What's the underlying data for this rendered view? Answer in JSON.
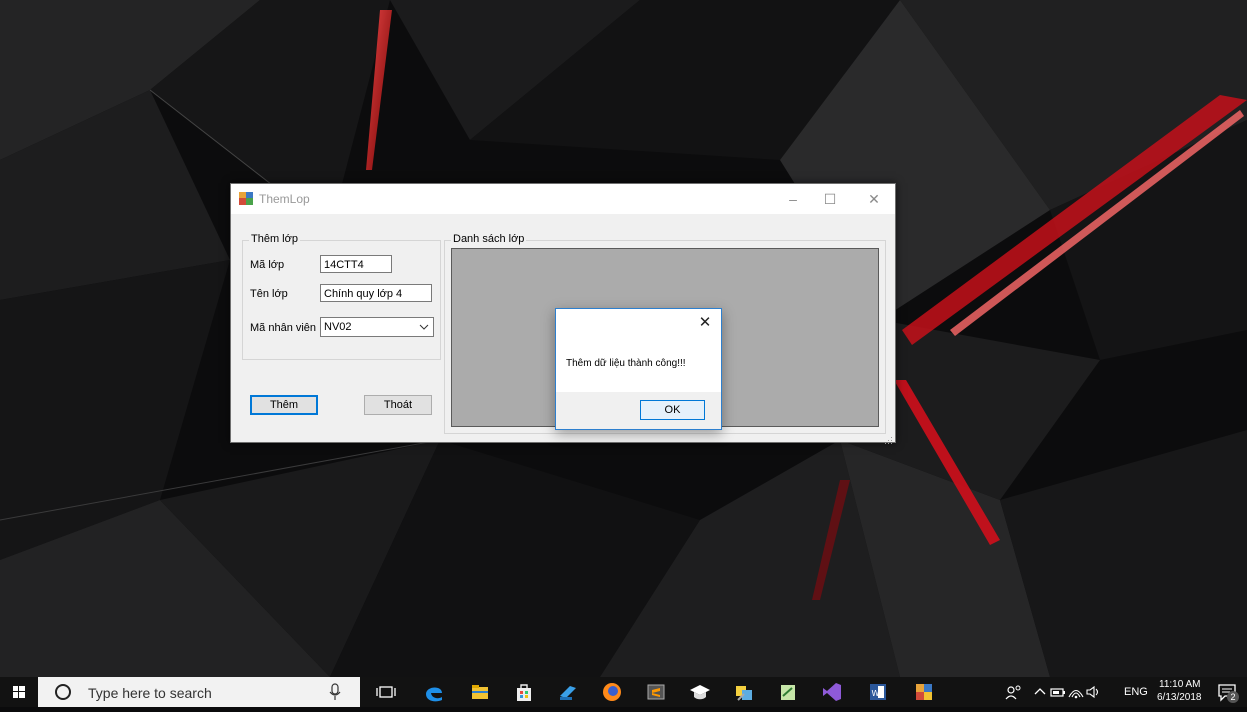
{
  "window": {
    "title": "ThemLop",
    "group_them_lop": {
      "legend": "Thêm lớp",
      "ma_lop_label": "Mã lớp",
      "ma_lop_value": "14CTT4",
      "ten_lop_label": "Tên lớp",
      "ten_lop_value": "Chính quy lớp 4",
      "ma_nv_label": "Mã nhân viên",
      "ma_nv_value": "NV02"
    },
    "buttons": {
      "them": "Thêm",
      "thoat": "Thoát"
    },
    "group_danh_sach": {
      "legend": "Danh sách lớp"
    }
  },
  "messagebox": {
    "text": "Thêm dữ liệu thành công!!!",
    "ok": "OK"
  },
  "taskbar": {
    "search_placeholder": "Type here to search",
    "language": "ENG",
    "time": "11:10 AM",
    "date": "6/13/2018",
    "notification_count": "2",
    "pinned_icons": [
      "microphone-icon",
      "task-view-icon",
      "edge-icon",
      "file-explorer-icon",
      "store-icon",
      "deploy-icon",
      "firefox-icon",
      "sublime-icon",
      "graduation-cap-icon",
      "tools-icon",
      "notepad-icon",
      "visual-studio-icon",
      "word-icon",
      "colorful-app-icon"
    ],
    "tray_icons": [
      "people-icon",
      "chevron-up-icon",
      "battery-icon",
      "wifi-icon",
      "volume-icon"
    ]
  },
  "colors": {
    "accent": "#0078d7",
    "taskbar": "#121212",
    "grid_bg": "#ababab"
  }
}
